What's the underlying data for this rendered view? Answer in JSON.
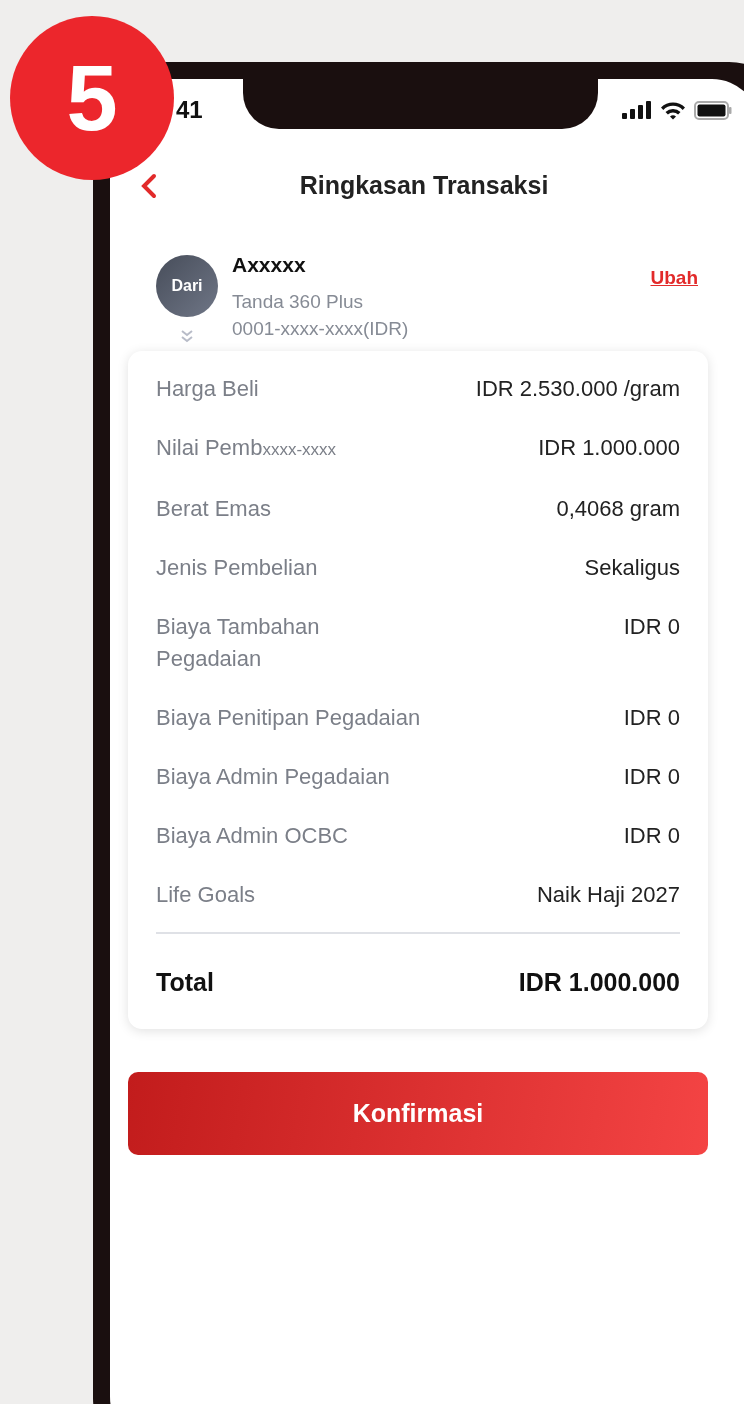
{
  "step_badge": "5",
  "status_bar": {
    "time": "41"
  },
  "header": {
    "title": "Ringkasan Transaksi"
  },
  "source": {
    "avatar_label": "Dari",
    "name": "Axxxxx",
    "product": "Tanda 360 Plus",
    "account": "0001-xxxx-xxxx(IDR)",
    "change_link": "Ubah"
  },
  "details": [
    {
      "label": "Harga Beli",
      "value": "IDR 2.530.000 /gram"
    },
    {
      "label": "Nilai Pemb",
      "overlay": "xxxx-xxxx",
      "value": "IDR 1.000.000"
    },
    {
      "label": "Berat Emas",
      "value": "0,4068 gram"
    },
    {
      "label": "Jenis Pembelian",
      "value": "Sekaligus"
    },
    {
      "label": "Biaya Tambahan Pegadaian",
      "value": "IDR 0"
    },
    {
      "label": "Biaya Penitipan Pegadaian",
      "value": "IDR 0"
    },
    {
      "label": "Biaya Admin Pegadaian",
      "value": "IDR 0"
    },
    {
      "label": "Biaya Admin OCBC",
      "value": "IDR 0"
    },
    {
      "label": "Life Goals",
      "value": "Naik Haji 2027"
    }
  ],
  "total": {
    "label": "Total",
    "value": "IDR 1.000.000"
  },
  "confirm_button": "Konfirmasi"
}
